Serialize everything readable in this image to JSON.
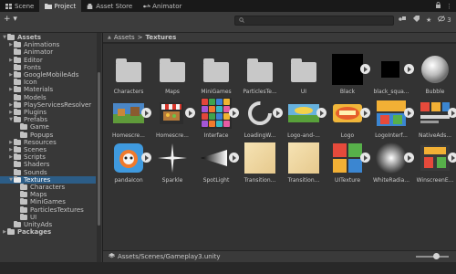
{
  "tabs": [
    {
      "label": "Scene",
      "icon": "scene-icon"
    },
    {
      "label": "Project",
      "icon": "project-folder-icon"
    },
    {
      "label": "Asset Store",
      "icon": "asset-store-icon"
    },
    {
      "label": "Animator",
      "icon": "animator-icon"
    }
  ],
  "active_tab": "Project",
  "toolbar": {
    "add_label": "+ ▾",
    "search_placeholder": "",
    "hidden_count": "3"
  },
  "tree": [
    {
      "label": "Assets",
      "depth": 0,
      "expanded": true,
      "bold": true
    },
    {
      "label": "Animations",
      "depth": 1,
      "arrow": true
    },
    {
      "label": "Animator",
      "depth": 1
    },
    {
      "label": "Editor",
      "depth": 1,
      "arrow": true
    },
    {
      "label": "Fonts",
      "depth": 1
    },
    {
      "label": "GoogleMobileAds",
      "depth": 1,
      "arrow": true
    },
    {
      "label": "Icon",
      "depth": 1
    },
    {
      "label": "Materials",
      "depth": 1,
      "arrow": true
    },
    {
      "label": "Models",
      "depth": 1
    },
    {
      "label": "PlayServicesResolver",
      "depth": 1,
      "arrow": true
    },
    {
      "label": "Plugins",
      "depth": 1,
      "arrow": true
    },
    {
      "label": "Prefabs",
      "depth": 1,
      "expanded": true
    },
    {
      "label": "Game",
      "depth": 2
    },
    {
      "label": "Popups",
      "depth": 2
    },
    {
      "label": "Resources",
      "depth": 1,
      "arrow": true
    },
    {
      "label": "Scenes",
      "depth": 1,
      "arrow": true
    },
    {
      "label": "Scripts",
      "depth": 1,
      "arrow": true
    },
    {
      "label": "Shaders",
      "depth": 1
    },
    {
      "label": "Sounds",
      "depth": 1
    },
    {
      "label": "Textures",
      "depth": 1,
      "expanded": true,
      "selected": true
    },
    {
      "label": "Characters",
      "depth": 2
    },
    {
      "label": "Maps",
      "depth": 2
    },
    {
      "label": "MiniGames",
      "depth": 2
    },
    {
      "label": "ParticlesTextures",
      "depth": 2
    },
    {
      "label": "UI",
      "depth": 2
    },
    {
      "label": "UnityAds",
      "depth": 1
    },
    {
      "label": "Packages",
      "depth": 0,
      "arrow": true,
      "bold": true
    }
  ],
  "breadcrumb": {
    "root": "Assets",
    "separator": ">",
    "current": "Textures"
  },
  "assets": [
    {
      "label": "Characters",
      "kind": "folder"
    },
    {
      "label": "Maps",
      "kind": "folder"
    },
    {
      "label": "MiniGames",
      "kind": "folder"
    },
    {
      "label": "ParticlesTe...",
      "kind": "folder"
    },
    {
      "label": "UI",
      "kind": "folder"
    },
    {
      "label": "Black",
      "kind": "black",
      "play": true
    },
    {
      "label": "black_squa...",
      "kind": "black-small",
      "play": true
    },
    {
      "label": "Bubble",
      "kind": "bubble"
    },
    {
      "label": "Homescre...",
      "kind": "landscape",
      "play": true
    },
    {
      "label": "Homescre...",
      "kind": "stall",
      "play": true
    },
    {
      "label": "Interface",
      "kind": "interface",
      "play": true
    },
    {
      "label": "LoadingW...",
      "kind": "loading",
      "play": true
    },
    {
      "label": "Logo-and-...",
      "kind": "logo-land",
      "play": true
    },
    {
      "label": "Logo",
      "kind": "logo",
      "play": true
    },
    {
      "label": "LogoInterf...",
      "kind": "logo-interface",
      "play": true
    },
    {
      "label": "NativeAds...",
      "kind": "native-ads",
      "play": true
    },
    {
      "label": "pandaIcon",
      "kind": "panda",
      "play": true
    },
    {
      "label": "Sparkle",
      "kind": "sparkle"
    },
    {
      "label": "SpotLight",
      "kind": "spotlight",
      "play": true
    },
    {
      "label": "Transition...",
      "kind": "gradient"
    },
    {
      "label": "Transition...",
      "kind": "gradient"
    },
    {
      "label": "UITexture",
      "kind": "ui-texture",
      "play": true
    },
    {
      "label": "WhiteRadia...",
      "kind": "white-radial",
      "play": true
    },
    {
      "label": "WinscreenE...",
      "kind": "winscreen",
      "play": true
    }
  ],
  "status": {
    "path": "Assets/Scenes/Gameplay3.unity"
  },
  "colors": {
    "selection": "#2c5d87",
    "panel": "#383838",
    "grid": "#333333"
  }
}
